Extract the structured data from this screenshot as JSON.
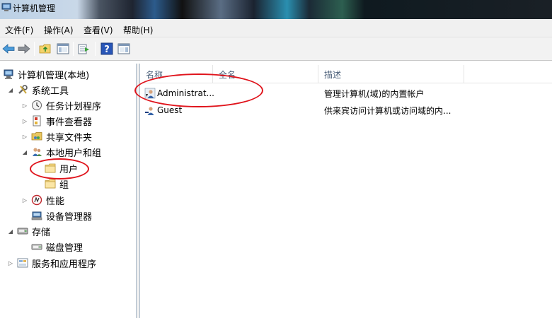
{
  "window": {
    "title": "计算机管理"
  },
  "menu": [
    {
      "label": "文件(F)"
    },
    {
      "label": "操作(A)"
    },
    {
      "label": "查看(V)"
    },
    {
      "label": "帮助(H)"
    }
  ],
  "toolbar": {
    "buttons": [
      "back-arrow-icon",
      "forward-arrow-icon",
      "up-folder-icon",
      "show-hide-tree-icon",
      "export-list-icon",
      "help-icon",
      "action-pane-icon"
    ]
  },
  "tree": {
    "root": "计算机管理(本地)",
    "system_tools": "系统工具",
    "task_scheduler": "任务计划程序",
    "event_viewer": "事件查看器",
    "shared_folders": "共享文件夹",
    "local_users_groups": "本地用户和组",
    "users": "用户",
    "groups": "组",
    "performance": "性能",
    "device_manager": "设备管理器",
    "storage": "存储",
    "disk_management": "磁盘管理",
    "services_apps": "服务和应用程序"
  },
  "list": {
    "columns": {
      "name": "名称",
      "fullname": "全名",
      "description": "描述"
    },
    "rows": [
      {
        "name": "Administrat...",
        "fullname": "",
        "description": "管理计算机(域)的内置帐户"
      },
      {
        "name": "Guest",
        "fullname": "",
        "description": "供来宾访问计算机或访问域的内..."
      }
    ]
  },
  "colors": {
    "annotation_red": "#e0141c",
    "header_text": "#4c607a"
  }
}
